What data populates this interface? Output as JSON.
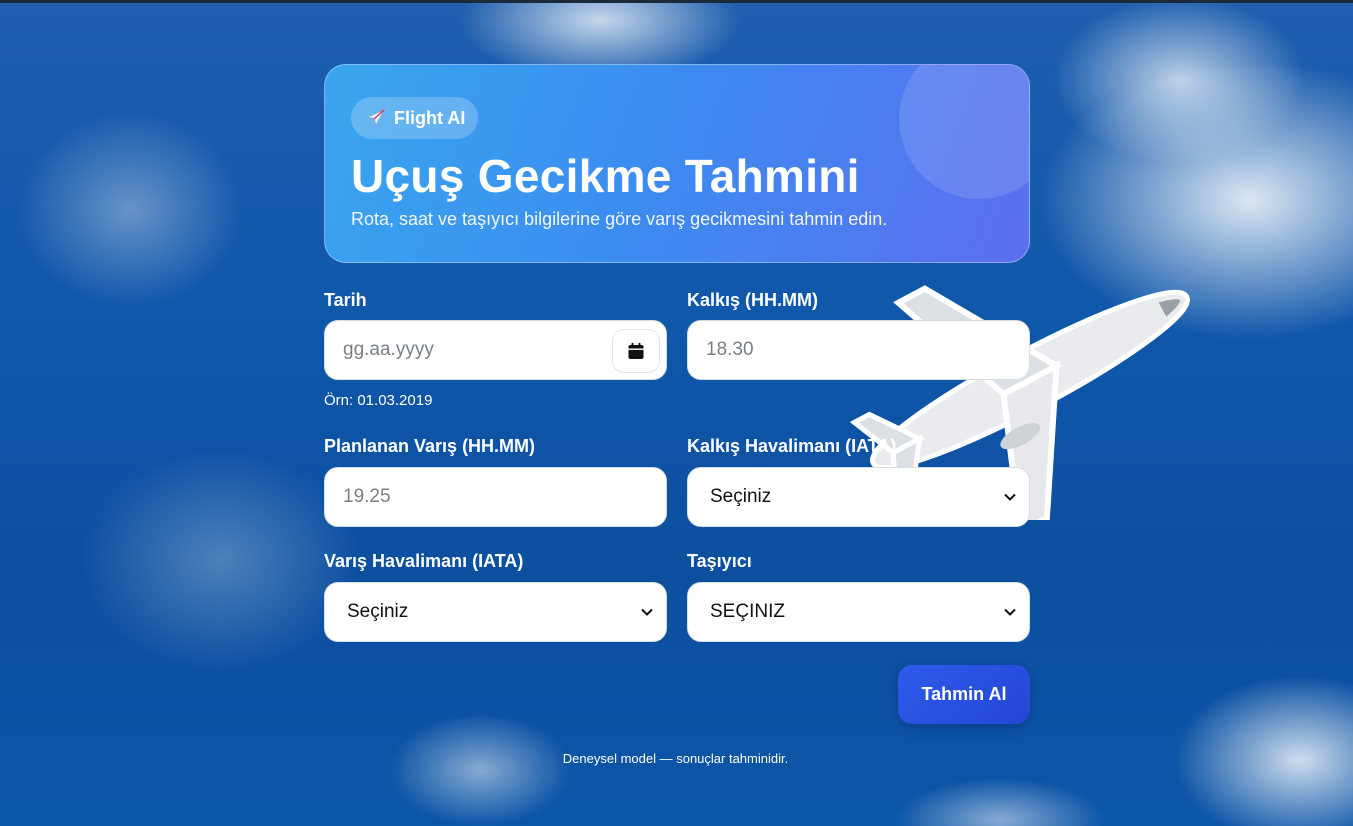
{
  "hero": {
    "badge_label": "Flight AI",
    "badge_icon": "airplane-icon",
    "title": "Uçuş Gecikme Tahmini",
    "subtitle": "Rota, saat ve taşıyıcı bilgilerine göre varış gecikmesini tahmin edin."
  },
  "form": {
    "date": {
      "label": "Tarih",
      "placeholder": "gg.aa.yyyy",
      "hint": "Örn: 01.03.2019",
      "icon": "calendar-icon"
    },
    "departure_time": {
      "label": "Kalkış (HH.MM)",
      "placeholder": "18.30"
    },
    "planned_arrival": {
      "label": "Planlanan Varış (HH.MM)",
      "placeholder": "19.25"
    },
    "departure_airport": {
      "label": "Kalkış Havalimanı (IATA)",
      "selected": "Seçiniz"
    },
    "arrival_airport": {
      "label": "Varış Havalimanı (IATA)",
      "selected": "Seçiniz"
    },
    "carrier": {
      "label": "Taşıyıcı",
      "selected": "SEÇINIZ"
    },
    "submit_label": "Tahmin Al"
  },
  "footer": {
    "note": "Deneysel model — sonuçlar tahminidir."
  },
  "colors": {
    "accent": "#2f5bea",
    "hero_start": "#3aa6ee",
    "hero_end": "#5c6ef0",
    "sky": "#0f57aa"
  }
}
